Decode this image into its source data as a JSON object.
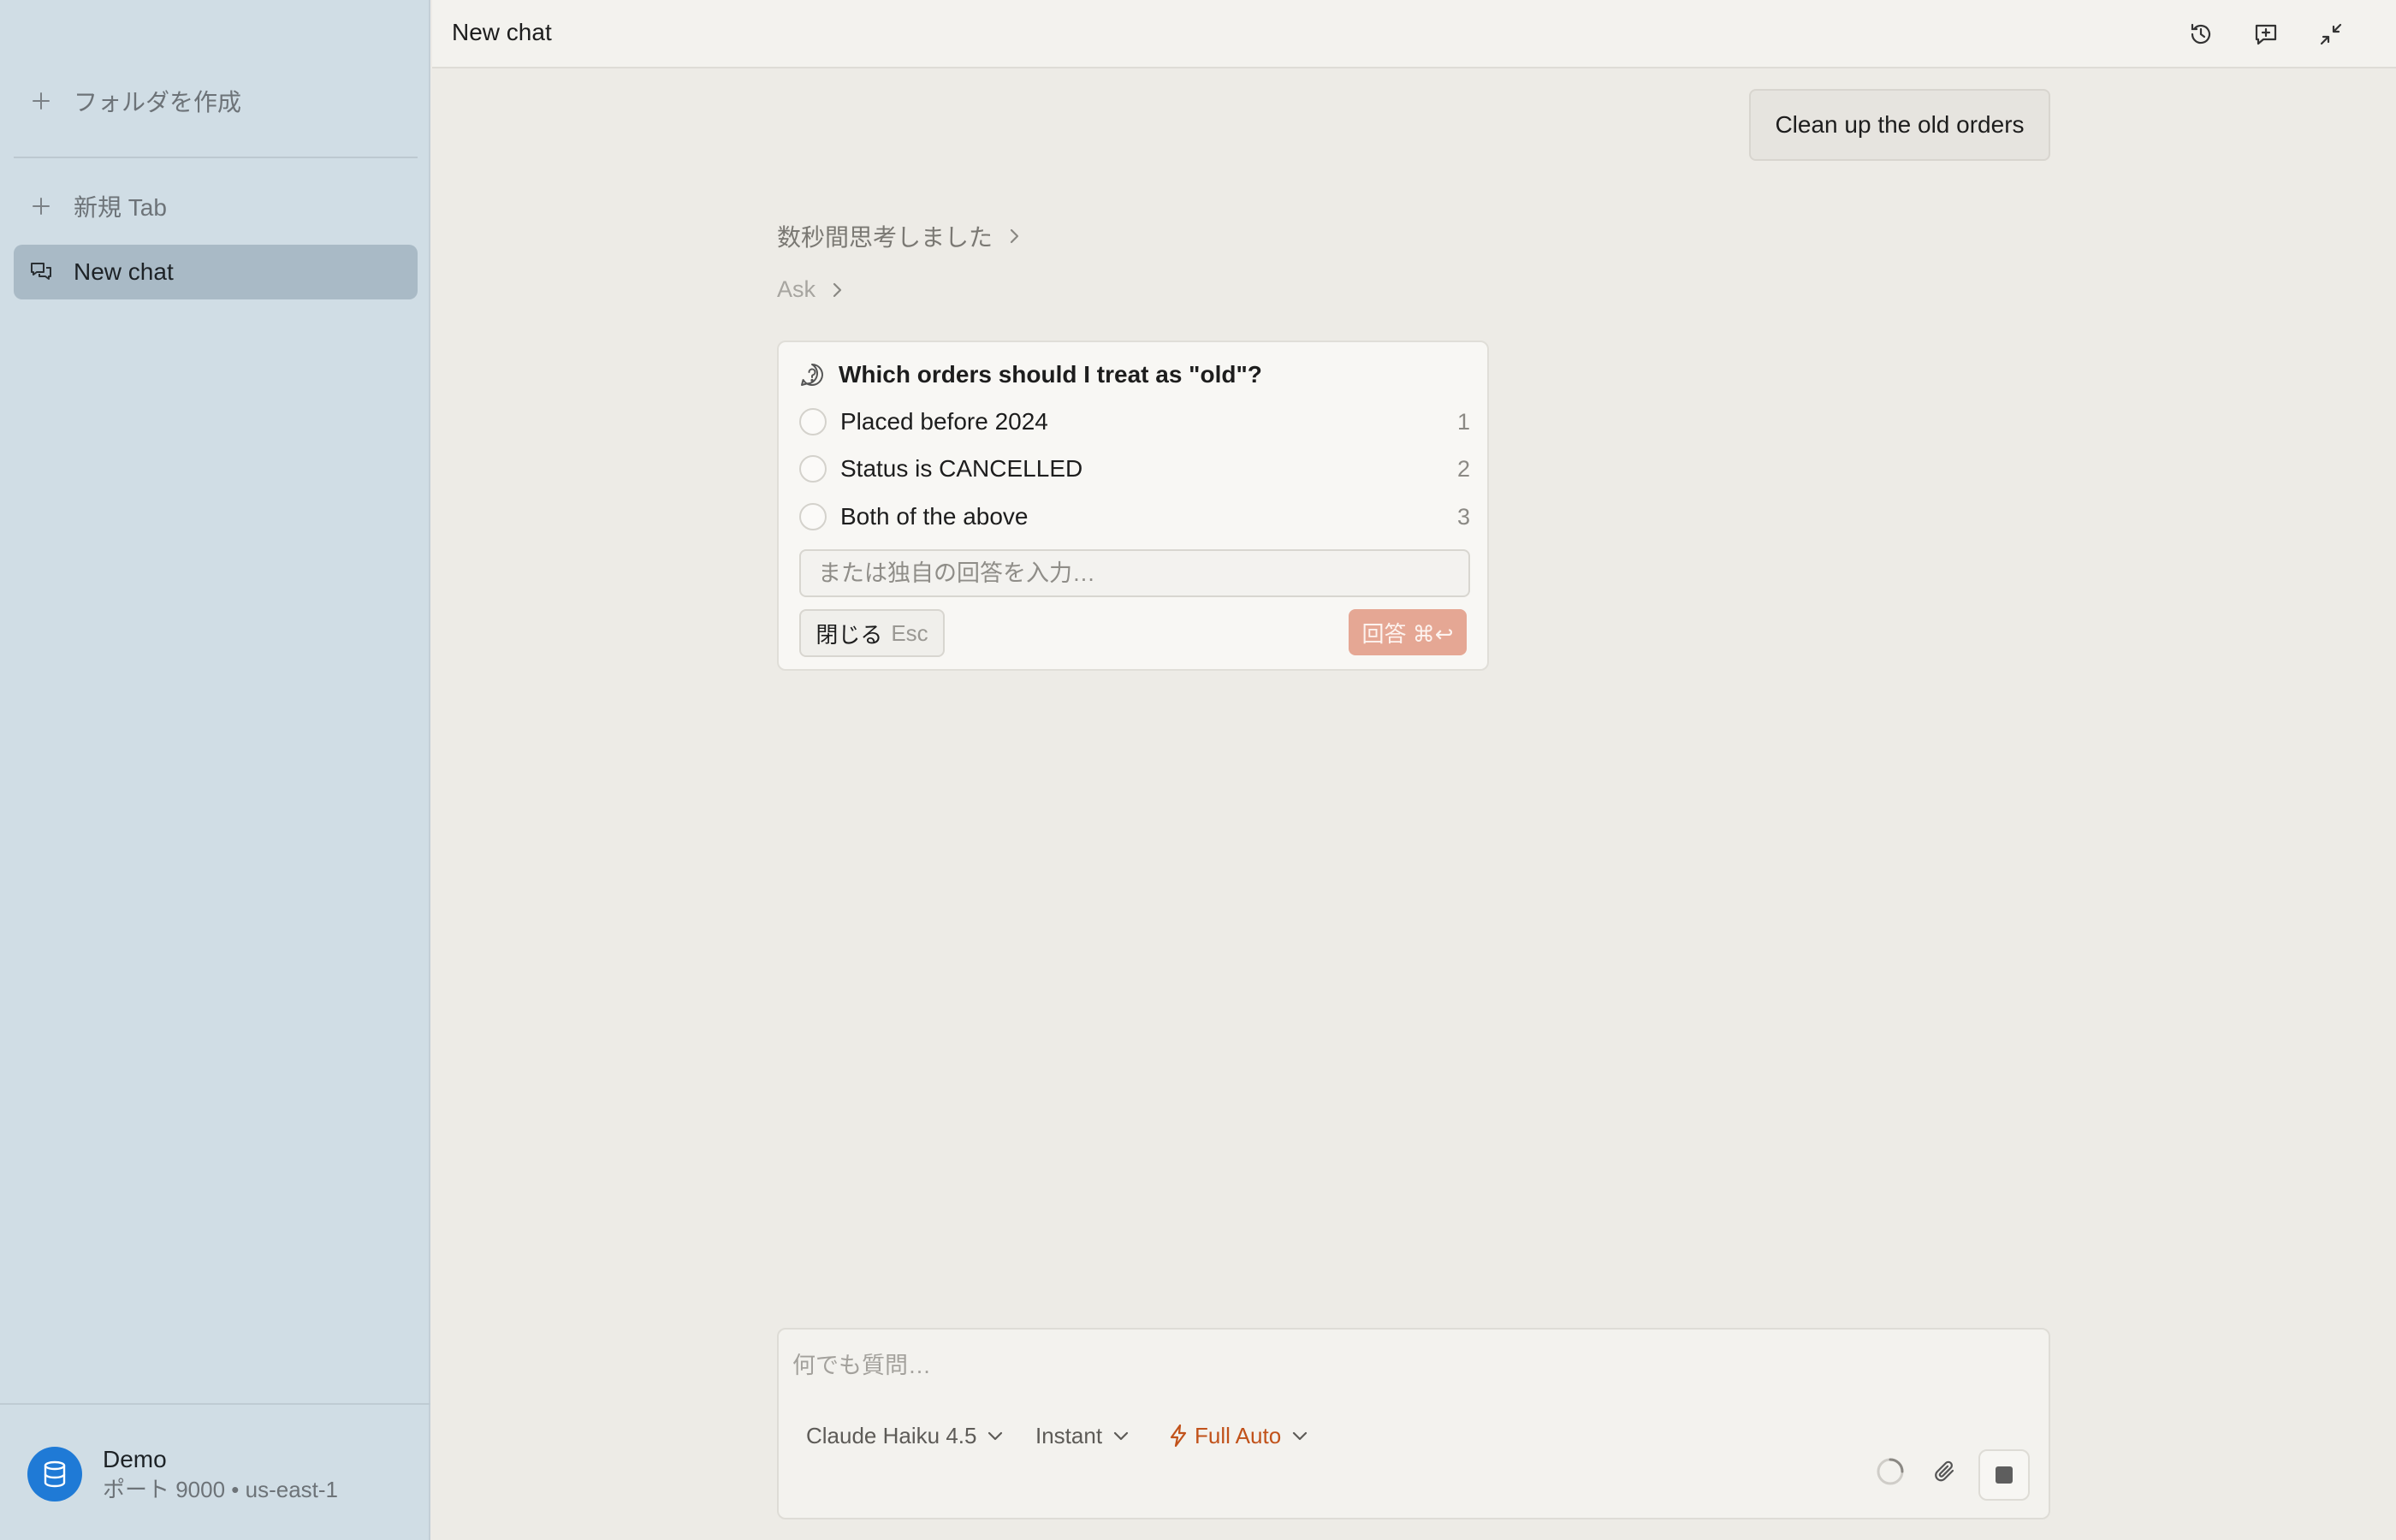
{
  "sidebar": {
    "create_folder": "フォルダを作成",
    "new_tab": "新規 Tab",
    "active_chat": "New chat",
    "account": {
      "name": "Demo",
      "detail": "ポート 9000 • us-east-1"
    }
  },
  "header": {
    "title": "New chat",
    "icons": [
      "history-icon",
      "new-chat-icon",
      "collapse-icon"
    ]
  },
  "conversation": {
    "user_message": "Clean up the old orders",
    "thought": "数秒間思考しました",
    "tool": "Ask"
  },
  "question_card": {
    "question": "Which orders should I treat as \"old\"?",
    "options": [
      {
        "label": "Placed before 2024",
        "key": "1"
      },
      {
        "label": "Status is CANCELLED",
        "key": "2"
      },
      {
        "label": "Both of the above",
        "key": "3"
      }
    ],
    "custom_placeholder": "または独自の回答を入力…",
    "close_label": "閉じる",
    "close_key": "Esc",
    "answer_label": "回答 ⌘↩"
  },
  "composer": {
    "placeholder": "何でも質問…",
    "model": "Claude Haiku 4.5",
    "mode": "Instant",
    "autonomy": "Full Auto"
  },
  "colors": {
    "sidebar_bg": "#d0dde5",
    "active_item": "#a9bac6",
    "accent_orange": "#c1521a",
    "answer_button": "#e5a794",
    "avatar_blue": "#1f7ad6"
  }
}
